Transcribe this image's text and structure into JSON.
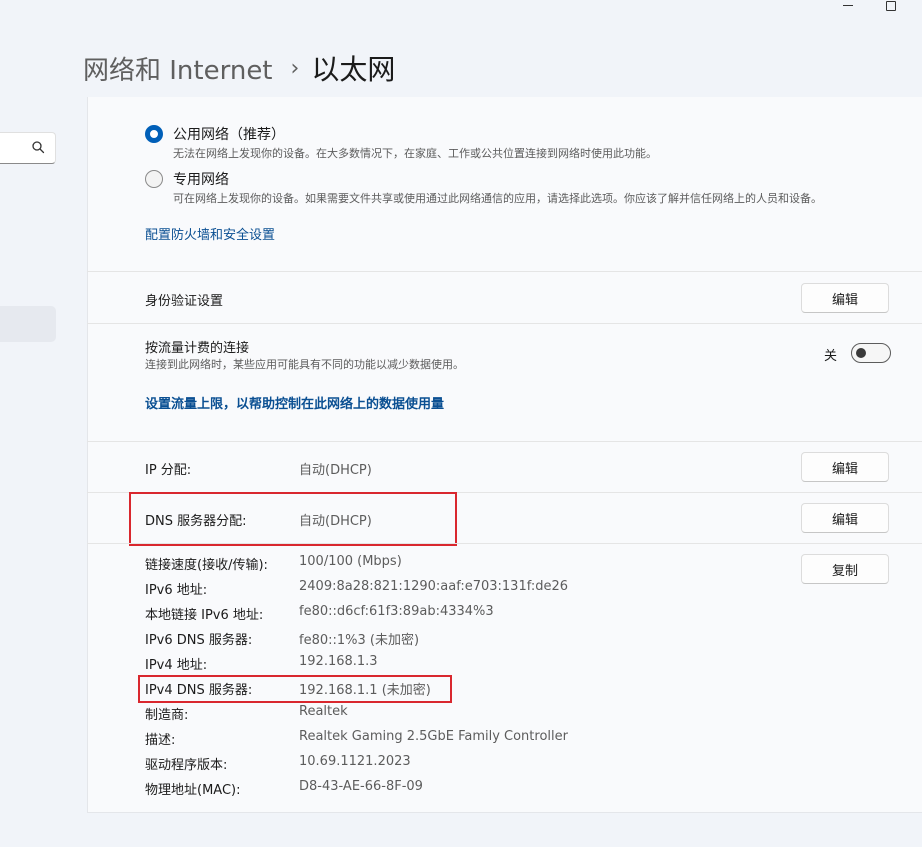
{
  "breadcrumb": {
    "parent": "网络和 Internet",
    "separator": "›",
    "current": "以太网"
  },
  "icons": {
    "search": "search-icon",
    "chevron": "chevron-right-icon"
  },
  "network_profile": {
    "options": [
      {
        "title": "公用网络（推荐）",
        "desc": "无法在网络上发现你的设备。在大多数情况下，在家庭、工作或公共位置连接到网络时使用此功能。",
        "selected": true
      },
      {
        "title": "专用网络",
        "desc": "可在网络上发现你的设备。如果需要文件共享或使用通过此网络通信的应用，请选择此选项。你应该了解并信任网络上的人员和设备。",
        "selected": false
      }
    ],
    "firewall_link": "配置防火墙和安全设置"
  },
  "auth": {
    "title": "身份验证设置",
    "button": "编辑"
  },
  "metered": {
    "title": "按流量计费的连接",
    "desc": "连接到此网络时，某些应用可能具有不同的功能以减少数据使用。",
    "toggle_label": "关",
    "toggle_on": false,
    "link": "设置流量上限，以帮助控制在此网络上的数据使用量"
  },
  "ip": {
    "label": "IP 分配:",
    "value": "自动(DHCP)",
    "button": "编辑"
  },
  "dns": {
    "label": "DNS 服务器分配:",
    "value": "自动(DHCP)",
    "button": "编辑"
  },
  "properties": {
    "copy_button": "复制",
    "rows": [
      {
        "label": "链接速度(接收/传输):",
        "value": "100/100 (Mbps)"
      },
      {
        "label": "IPv6 地址:",
        "value": "2409:8a28:821:1290:aaf:e703:131f:de26"
      },
      {
        "label": "本地链接 IPv6 地址:",
        "value": "fe80::d6cf:61f3:89ab:4334%3"
      },
      {
        "label": "IPv6 DNS 服务器:",
        "value": "fe80::1%3 (未加密)"
      },
      {
        "label": "IPv4 地址:",
        "value": "192.168.1.3"
      },
      {
        "label": "IPv4 DNS 服务器:",
        "value": "192.168.1.1 (未加密)"
      },
      {
        "label": "制造商:",
        "value": "Realtek"
      },
      {
        "label": "描述:",
        "value": "Realtek Gaming 2.5GbE Family Controller"
      },
      {
        "label": "驱动程序版本:",
        "value": "10.69.1121.2023"
      },
      {
        "label": "物理地址(MAC):",
        "value": "D8-43-AE-66-8F-09"
      }
    ]
  },
  "colors": {
    "accent": "#005fb8",
    "link": "#0a4f92",
    "highlight": "#d9272e"
  }
}
